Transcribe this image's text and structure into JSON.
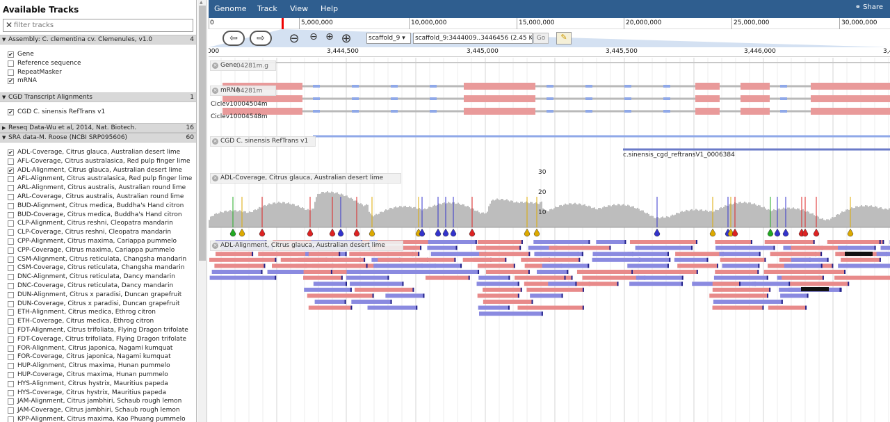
{
  "sidebar": {
    "title": "Available Tracks",
    "filter_placeholder": "filter tracks",
    "categories": [
      {
        "label": "Assembly: C. clementina cv. Clemenules, v1.0",
        "count": "4"
      },
      {
        "label": "CGD Transcript Alignments",
        "count": "1"
      },
      {
        "label": "Reseq Data-Wu et al, 2014, Nat. Biotech.",
        "count": "16"
      },
      {
        "label": "SRA data-M. Roose (NCBI SRP095606)",
        "count": "60"
      }
    ],
    "assembly_tracks": [
      {
        "label": "Gene",
        "checked": "✔"
      },
      {
        "label": "Reference sequence",
        "checked": ""
      },
      {
        "label": "RepeatMasker",
        "checked": ""
      },
      {
        "label": "mRNA",
        "checked": "✔"
      }
    ],
    "cgd_tracks": [
      {
        "label": "CGD C. sinensis RefTrans v1",
        "checked": "✔"
      }
    ],
    "sra_tracks": [
      {
        "label": "ADL-Coverage, Citrus glauca, Australian desert lime",
        "checked": "✔"
      },
      {
        "label": "AFL-Coverage, Citrus australasica, Red pulp finger lime",
        "checked": ""
      },
      {
        "label": "ADL-Alignment, Citrus glauca, Australian desert lime",
        "checked": "✔"
      },
      {
        "label": "AFL-Alignment, Citrus australasica, Red pulp finger lime",
        "checked": ""
      },
      {
        "label": "ARL-Alignment, Citrus australis, Australian round lime",
        "checked": ""
      },
      {
        "label": "ARL-Coverage, Citrus australis, Australian round lime",
        "checked": ""
      },
      {
        "label": "BUD-Alignment, Citrus medica, Buddha's Hand citron",
        "checked": ""
      },
      {
        "label": "BUD-Coverage, Citrus medica, Buddha's Hand citron",
        "checked": ""
      },
      {
        "label": "CLP-Alignment, Citrus reshni, Cleopatra mandarin",
        "checked": ""
      },
      {
        "label": "CLP-Coverage, Citrus reshni, Cleopatra mandarin",
        "checked": ""
      },
      {
        "label": "CPP-Alignment, Citrus maxima, Cariappa pummelo",
        "checked": ""
      },
      {
        "label": "CPP-Coverage, Citrus maxima, Cariappa pummelo",
        "checked": ""
      },
      {
        "label": "CSM-Alignment, Citrus reticulata, Changsha mandarin",
        "checked": ""
      },
      {
        "label": "CSM-Coverage, Citrus reticulata, Changsha mandarin",
        "checked": ""
      },
      {
        "label": "DNC-Alignment, Citrus reticulata, Dancy mandarin",
        "checked": ""
      },
      {
        "label": "DNC-Coverage, Citrus reticulata, Dancy mandarin",
        "checked": ""
      },
      {
        "label": "DUN-Alignment, Citrus x paradisi, Duncan grapefruit",
        "checked": ""
      },
      {
        "label": "DUN-Coverage, Citrus x paradisi, Duncan grapefruit",
        "checked": ""
      },
      {
        "label": "ETH-Alignment, Citrus medica, Ethrog citron",
        "checked": ""
      },
      {
        "label": "ETH-Coverage, Citrus medica, Ethrog citron",
        "checked": ""
      },
      {
        "label": "FDT-Alignment, Citrus trifoliata, Flying Dragon trifolate",
        "checked": ""
      },
      {
        "label": "FDT-Coverage, Citrus trifoliata, Flying Dragon trifolate",
        "checked": ""
      },
      {
        "label": "FOR-Alignment, Citrus japonica, Nagami kumquat",
        "checked": ""
      },
      {
        "label": "FOR-Coverage, Citrus japonica, Nagami kumquat",
        "checked": ""
      },
      {
        "label": "HUP-Alignment, Citrus maxima, Hunan pummelo",
        "checked": ""
      },
      {
        "label": "HUP-Coverage, Citrus maxima, Hunan pummelo",
        "checked": ""
      },
      {
        "label": "HYS-Alignment, Citrus hystrix, Mauritius papeda",
        "checked": ""
      },
      {
        "label": "HYS-Coverage, Citrus hystrix, Mauritius papeda",
        "checked": ""
      },
      {
        "label": "JAM-Alignment, Citrus jambhiri, Schaub rough lemon",
        "checked": ""
      },
      {
        "label": "JAM-Coverage, Citrus jambhiri, Schaub rough lemon",
        "checked": ""
      },
      {
        "label": "KPP-Alignment, Citrus maxima, Kao Phuang pummelo",
        "checked": ""
      }
    ]
  },
  "menubar": {
    "items": [
      "Genome",
      "Track",
      "View",
      "Help"
    ],
    "share": "Share"
  },
  "overview": {
    "ticks": [
      "0",
      "5,000,000",
      "10,000,000",
      "15,000,000",
      "20,000,000",
      "25,000,000",
      "30,000,000"
    ]
  },
  "nav": {
    "ref_sequence": "scaffold_9",
    "location": "scaffold_9:3444009..3446456 (2.45 Kb)",
    "go_label": "Go",
    "back_icon": "left-arrow-icon",
    "forward_icon": "right-arrow-icon",
    "highlight_icon": "highlighter-icon"
  },
  "ruler": {
    "ticks": [
      "000",
      "3,444,500",
      "3,445,000",
      "3,445,500",
      "3,446,000",
      "3,4"
    ]
  },
  "tracks": {
    "gene_label": "Gene",
    "gene_partial": "04281m.g",
    "mrna_label": "mRNA",
    "mrna_partial": "04281m",
    "mrna_features": [
      "Ciclev10004504m",
      "Ciclev10004548m"
    ],
    "cgd_label": "CGD C. sinensis RefTrans v1",
    "cgd_feature": "c.sinensis_cgd_reftransV1_0006384",
    "coverage_label": "ADL-Coverage, Citrus glauca, Australian desert lime",
    "coverage_scale": [
      "30",
      "20",
      "10"
    ],
    "alignment_label": "ADL-Alignment, Citrus glauca, Australian desert lime"
  },
  "colors": {
    "menubar": "#2f5e8f",
    "exon": "#e99a9a",
    "intron": "#b9b9b9",
    "utr": "#8fa8e8",
    "read_forward": "#e88a8a",
    "read_reverse": "#8a8ae0",
    "coverage": "#bdbdbd"
  }
}
